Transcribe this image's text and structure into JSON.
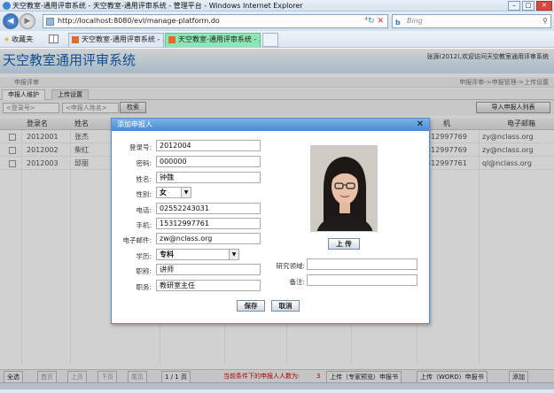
{
  "browser": {
    "window_title": "天空教室-通用评审系统 - 天空教室-通用评审系统 - 管理平台 - Windows Internet Explorer",
    "address": "http://localhost:8080/evl/manage-platform.do",
    "search_placeholder": "Bing",
    "favorites_label": "收藏夹",
    "tabs": [
      {
        "label": "天空教室-通用评审系统 - ..."
      },
      {
        "label": "天空教室-通用评审系统 - ..."
      }
    ]
  },
  "app": {
    "title": "天空教室通用评审系统",
    "welcome": "张源(2012),欢迎访问天空教室通用评审系统",
    "section": "申报评审",
    "breadcrumb": "申报评审->申报管理->上传设置"
  },
  "page_tabs": [
    "申报人维护",
    "上传设置"
  ],
  "toolbar": {
    "login_placeholder": "<登录号>",
    "name_placeholder": "<申报人姓名>",
    "search_label": "检索",
    "import_label": "导入申报人列表"
  },
  "table": {
    "headers": [
      "登录名",
      "姓名",
      "机",
      "电子邮箱"
    ],
    "rows": [
      {
        "login": "2012001",
        "name": "张杰",
        "phone": "312997769",
        "email": "zy@nclass.org"
      },
      {
        "login": "2012002",
        "name": "柴红",
        "phone": "312997769",
        "email": "zy@nclass.org"
      },
      {
        "login": "2012003",
        "name": "邱丽",
        "phone": "312997761",
        "email": "ql@nclass.org"
      }
    ]
  },
  "pager": {
    "select_all": "全选",
    "first": "首页",
    "prev": "上页",
    "next": "下页",
    "last": "尾页",
    "page": "1 / 1 页",
    "count_label": "当前条件下的申报人人数为:",
    "count": "3",
    "upload_expert": "上传（专家预览）申报书",
    "upload_word": "上传（WORD）申报书",
    "add": "添加"
  },
  "dialog": {
    "title": "添加申报人",
    "fields": {
      "login": {
        "label": "登录号:",
        "value": "2012004"
      },
      "password": {
        "label": "密码:",
        "value": "000000"
      },
      "name": {
        "label": "姓名:",
        "value": "钟魏"
      },
      "gender": {
        "label": "性别:",
        "value": "女"
      },
      "phone": {
        "label": "电话:",
        "value": "02552243031"
      },
      "mobile": {
        "label": "手机:",
        "value": "15312997761"
      },
      "email": {
        "label": "电子邮件:",
        "value": "zw@nclass.org"
      },
      "education": {
        "label": "学历:",
        "value": "专科"
      },
      "title": {
        "label": "职称:",
        "value": "讲师"
      },
      "position": {
        "label": "职务:",
        "value": "教研室主任"
      },
      "research": {
        "label": "研究领域:",
        "value": ""
      },
      "remark": {
        "label": "备注:",
        "value": ""
      }
    },
    "upload_label": "上 传",
    "save_label": "保存",
    "cancel_label": "取消"
  }
}
